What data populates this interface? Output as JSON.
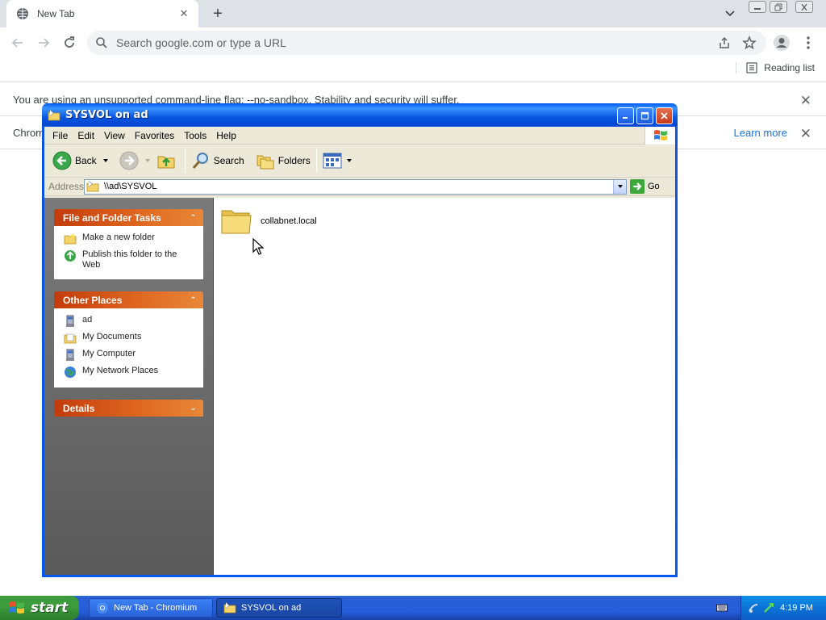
{
  "browser": {
    "tab": {
      "title": "New Tab"
    },
    "omnibox": {
      "placeholder": "Search google.com or type a URL"
    },
    "bookmarks": {
      "reading_list": "Reading list"
    },
    "infobars": [
      {
        "text": "You are using an unsupported command-line flag: --no-sandbox. Stability and security will suffer."
      },
      {
        "text": "Chromi",
        "link": "Learn more"
      }
    ]
  },
  "explorer": {
    "title": "SYSVOL on ad",
    "menu": [
      "File",
      "Edit",
      "View",
      "Favorites",
      "Tools",
      "Help"
    ],
    "toolbar": {
      "back": "Back",
      "search": "Search",
      "folders": "Folders"
    },
    "address": {
      "label": "Address",
      "value": "\\\\ad\\SYSVOL",
      "go": "Go"
    },
    "taskpane": {
      "file_tasks": {
        "title": "File and Folder Tasks",
        "items": [
          "Make a new folder",
          "Publish this folder to the Web"
        ]
      },
      "other_places": {
        "title": "Other Places",
        "items": [
          "ad",
          "My Documents",
          "My Computer",
          "My Network Places"
        ]
      },
      "details": {
        "title": "Details"
      }
    },
    "files": [
      {
        "name": "collabnet.local"
      }
    ]
  },
  "taskbar": {
    "start": "start",
    "tasks": [
      {
        "label": "New Tab - Chromium"
      },
      {
        "label": "SYSVOL on ad"
      }
    ],
    "clock": "4:19 PM"
  },
  "colors": {
    "xp_title_blue": "#0058ee",
    "xp_taskpane_orange": "#e06a22",
    "chrome_link": "#1a73e8"
  }
}
